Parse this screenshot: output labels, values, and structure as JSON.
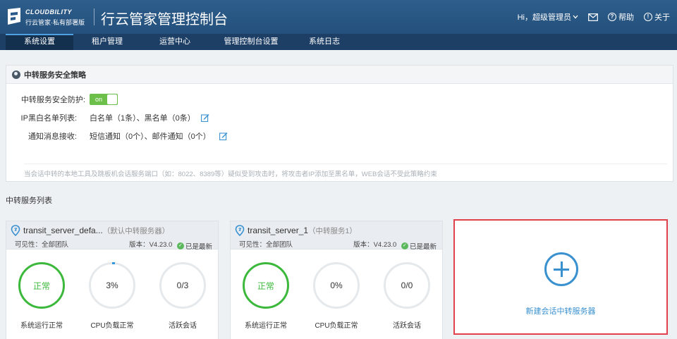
{
  "header": {
    "logo_en": "CLOUDBILITY",
    "logo_cn": "行云管家·私有部署版",
    "app_title": "行云管家管理控制台",
    "greeting": "Hi，超级管理员",
    "help_label": "帮助",
    "about_label": "关于"
  },
  "nav": {
    "items": [
      {
        "label": "系统设置",
        "active": true
      },
      {
        "label": "租户管理",
        "active": false
      },
      {
        "label": "运营中心",
        "active": false
      },
      {
        "label": "管理控制台设置",
        "active": false
      },
      {
        "label": "系统日志",
        "active": false
      }
    ]
  },
  "policy": {
    "title": "中转服务安全策略",
    "protect_label": "中转服务安全防护:",
    "protect_toggle": "on",
    "ip_label": "IP黑白名单列表:",
    "ip_value": "白名单（1条）、黑名单（0条）",
    "notify_label": "通知消息接收:",
    "notify_value": "短信通知（0个）、邮件通知（0个）",
    "note": "当会话中转的本地工具及跳板机会话服务端口（如：8022、8389等）疑似受到攻击时，将攻击者IP添加至黑名单，WEB会话不受此策略约束"
  },
  "server_list": {
    "title": "中转服务列表",
    "cards": [
      {
        "name": "transit_server_defa...",
        "subtitle": "（默认中转服务器）",
        "visibility": "可见性：全部团队",
        "version": "版本：V4.23.0",
        "latest": "已是最新",
        "status_value": "正常",
        "status_label": "系统运行正常",
        "cpu_value": "3%",
        "cpu_label": "CPU负载正常",
        "sessions_value": "0/3",
        "sessions_label": "活跃会话"
      },
      {
        "name": "transit_server_1",
        "subtitle": "（中转服务1）",
        "visibility": "可见性：全部团队",
        "version": "版本：V4.23.0",
        "latest": "已是最新",
        "status_value": "正常",
        "status_label": "系统运行正常",
        "cpu_value": "0%",
        "cpu_label": "CPU负载正常",
        "sessions_value": "0/0",
        "sessions_label": "活跃会话"
      }
    ],
    "add_label": "新建会话中转服务器"
  },
  "colors": {
    "header": "#23507c",
    "nav": "#1d3f66",
    "ok_green": "#3cb93c",
    "accent_blue": "#3a91d0",
    "highlight_red": "#e0414b"
  }
}
